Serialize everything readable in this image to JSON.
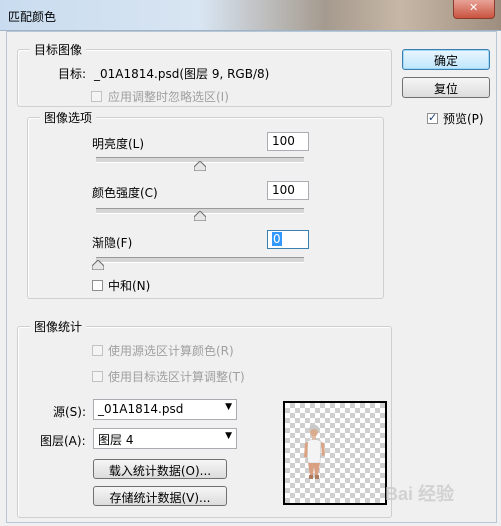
{
  "window": {
    "title": "匹配颜色"
  },
  "buttons": {
    "ok": "确定",
    "reset": "复位"
  },
  "preview_option": {
    "label": "预览(P)",
    "checked": true
  },
  "target_image": {
    "legend": "目标图像",
    "target_label": "目标:",
    "target_value": "_01A1814.psd(图层 9, RGB/8)",
    "ignore_selection_label": "应用调整时忽略选区(I)"
  },
  "image_options": {
    "legend": "图像选项",
    "luminance": {
      "label": "明亮度(L)",
      "value": "100",
      "level": 100,
      "max": 200
    },
    "color_intensity": {
      "label": "颜色强度(C)",
      "value": "100",
      "level": 100,
      "max": 200
    },
    "fade": {
      "label": "渐隐(F)",
      "value": "0",
      "level": 0,
      "max": 100
    },
    "neutralize": {
      "label": "中和(N)",
      "checked": false
    }
  },
  "image_statistics": {
    "legend": "图像统计",
    "use_source_selection": "使用源选区计算颜色(R)",
    "use_target_selection": "使用目标选区计算调整(T)",
    "source_label": "源(S):",
    "source_value": "_01A1814.psd",
    "layer_label": "图层(A):",
    "layer_value": "图层 4",
    "load_button": "载入统计数据(O)...",
    "save_button": "存储统计数据(V)..."
  },
  "watermark": "Bai 经验"
}
